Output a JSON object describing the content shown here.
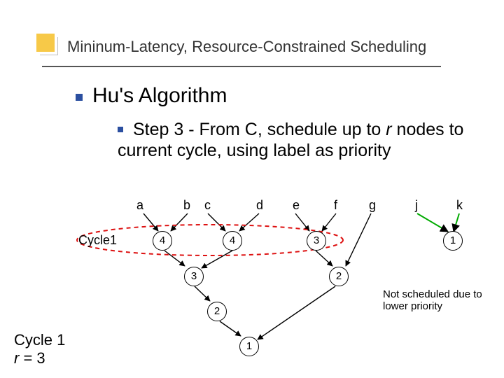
{
  "title": "Mininum-Latency, Resource-Constrained Scheduling",
  "line1": "Hu's Algorithm",
  "line2_pre": "Step 3 - From C, schedule up to ",
  "line2_r": "r",
  "line2_post": " nodes to current cycle, using label as priority",
  "labels": {
    "a": "a",
    "b": "b",
    "c": "c",
    "d": "d",
    "e": "e",
    "f": "f",
    "g": "g",
    "j": "j",
    "k": "k"
  },
  "nodes": {
    "n4a": "4",
    "n4b": "4",
    "n3a": "3",
    "n3b": "3",
    "n2a": "2",
    "n2b": "2",
    "n1a": "1",
    "n1b": "1"
  },
  "cycle_inline": "Cycle1",
  "footer_cycle": "Cycle 1",
  "footer_r_var": "r",
  "footer_r_rest": " = 3",
  "note": "Not scheduled due to lower priority"
}
